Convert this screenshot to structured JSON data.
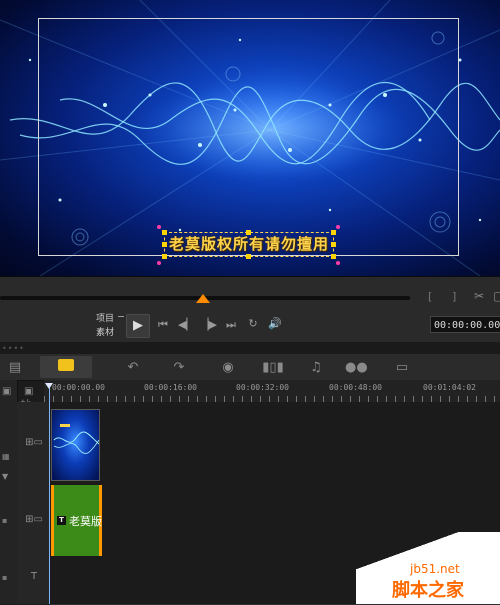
{
  "preview": {
    "caption": "老莫版权所有请勿擅用"
  },
  "player": {
    "project_label": "项目",
    "clip_label": "素材",
    "timecode": "00:00:00.00",
    "icons": [
      "play-icon",
      "home-icon",
      "prev-frame-icon",
      "next-frame-icon",
      "end-icon",
      "repeat-icon",
      "volume-icon",
      "mark-in-icon",
      "mark-out-icon",
      "cut-icon"
    ]
  },
  "toolbar": {
    "icons": [
      "storyboard-icon",
      "timeline-icon",
      "undo-icon",
      "redo-icon",
      "record-capture-icon",
      "sound-mixer-icon",
      "auto-music-icon",
      "motion-track-icon",
      "subtitle-icon"
    ]
  },
  "timeline": {
    "ruler": [
      "00:00:00.00",
      "00:00:16:00",
      "00:00:32:00",
      "00:00:48:00",
      "00:01:04:02"
    ],
    "zoom_label": "+/-",
    "title_clip_text": "老莫版",
    "title_clip_badge": "T"
  },
  "watermark": {
    "site": "jb51.net",
    "text": "脚本之家"
  },
  "colors": {
    "accent": "#ff8c00",
    "caption": "#ffd34a",
    "title_clip": "#3c8a17"
  }
}
